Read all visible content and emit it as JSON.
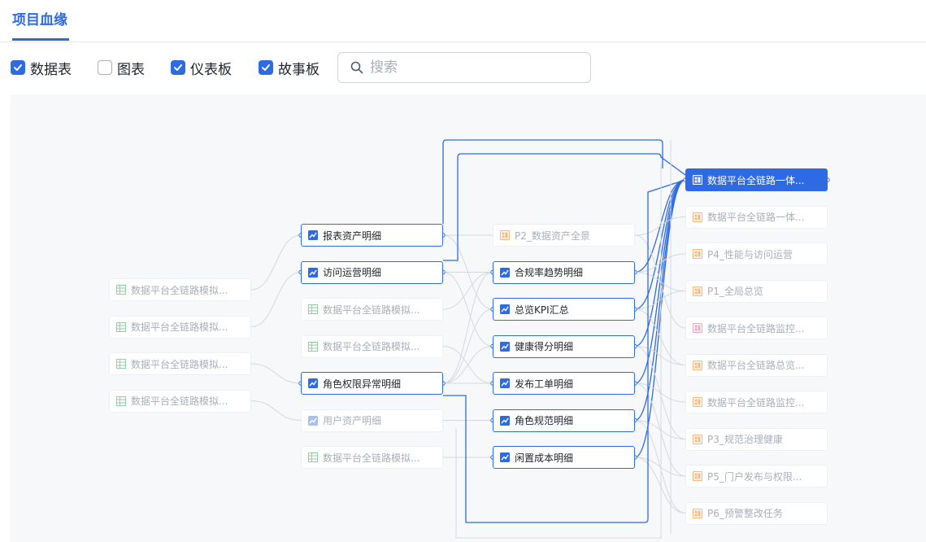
{
  "header": {
    "tab_label": "项目血缘"
  },
  "filters": [
    {
      "label": "数据表",
      "checked": true
    },
    {
      "label": "图表",
      "checked": false
    },
    {
      "label": "仪表板",
      "checked": true
    },
    {
      "label": "故事板",
      "checked": true
    }
  ],
  "search": {
    "placeholder": "搜索"
  },
  "colors": {
    "accent": "#2d6ae3",
    "table_icon": "#8fd19e",
    "chart_icon": "#2d6ae3",
    "dashboard_icon": "#f5b97f",
    "story_icon": "#f4a8bf"
  },
  "nodes": [
    {
      "id": "t1",
      "type": "table",
      "label": "数据平台全链路模拟...",
      "state": "dim",
      "col": 0,
      "row": 0
    },
    {
      "id": "t2",
      "type": "table",
      "label": "数据平台全链路模拟...",
      "state": "dim",
      "col": 0,
      "row": 1
    },
    {
      "id": "t3",
      "type": "table",
      "label": "数据平台全链路模拟...",
      "state": "dim",
      "col": 0,
      "row": 2
    },
    {
      "id": "t4",
      "type": "table",
      "label": "数据平台全链路模拟...",
      "state": "dim",
      "col": 0,
      "row": 3
    },
    {
      "id": "c1",
      "type": "chart",
      "label": "报表资产明细",
      "state": "active",
      "col": 1,
      "row": 0
    },
    {
      "id": "c2",
      "type": "chart",
      "label": "访问运营明细",
      "state": "active",
      "col": 1,
      "row": 1
    },
    {
      "id": "c3",
      "type": "table",
      "label": "数据平台全链路模拟...",
      "state": "dim",
      "col": 1,
      "row": 2
    },
    {
      "id": "c4",
      "type": "table",
      "label": "数据平台全链路模拟...",
      "state": "dim",
      "col": 1,
      "row": 3
    },
    {
      "id": "c5",
      "type": "chart",
      "label": "角色权限异常明细",
      "state": "active",
      "col": 1,
      "row": 4
    },
    {
      "id": "c6",
      "type": "chart",
      "label": "用户资产明细",
      "state": "dim",
      "col": 1,
      "row": 5
    },
    {
      "id": "c7",
      "type": "table",
      "label": "数据平台全链路模拟...",
      "state": "dim",
      "col": 1,
      "row": 6
    },
    {
      "id": "m0",
      "type": "dashboard",
      "label": "P2_数据资产全景",
      "state": "dim",
      "col": 2,
      "row": 0
    },
    {
      "id": "m1",
      "type": "chart",
      "label": "合规率趋势明细",
      "state": "active",
      "col": 2,
      "row": 1
    },
    {
      "id": "m2",
      "type": "chart",
      "label": "总览KPI汇总",
      "state": "active",
      "col": 2,
      "row": 2
    },
    {
      "id": "m3",
      "type": "chart",
      "label": "健康得分明细",
      "state": "active",
      "col": 2,
      "row": 3
    },
    {
      "id": "m4",
      "type": "chart",
      "label": "发布工单明细",
      "state": "active",
      "col": 2,
      "row": 4
    },
    {
      "id": "m5",
      "type": "chart",
      "label": "角色规范明细",
      "state": "active",
      "col": 2,
      "row": 5
    },
    {
      "id": "m6",
      "type": "chart",
      "label": "闲置成本明细",
      "state": "active",
      "col": 2,
      "row": 6
    },
    {
      "id": "d0",
      "type": "dashboard",
      "label": "数据平台全链路一体...",
      "state": "selected",
      "col": 3,
      "row": 0
    },
    {
      "id": "d1",
      "type": "dashboard",
      "label": "数据平台全链路一体...",
      "state": "dim",
      "col": 3,
      "row": 1
    },
    {
      "id": "d2",
      "type": "dashboard",
      "label": "P4_性能与访问运营",
      "state": "dim",
      "col": 3,
      "row": 2
    },
    {
      "id": "d3",
      "type": "dashboard",
      "label": "P1_全局总览",
      "state": "dim",
      "col": 3,
      "row": 3
    },
    {
      "id": "d4",
      "type": "story",
      "label": "数据平台全链路监控...",
      "state": "dim",
      "col": 3,
      "row": 4
    },
    {
      "id": "d5",
      "type": "dashboard",
      "label": "数据平台全链路总览...",
      "state": "dim",
      "col": 3,
      "row": 5
    },
    {
      "id": "d6",
      "type": "dashboard",
      "label": "数据平台全链路监控...",
      "state": "dim",
      "col": 3,
      "row": 6
    },
    {
      "id": "d7",
      "type": "dashboard",
      "label": "P3_规范治理健康",
      "state": "dim",
      "col": 3,
      "row": 7
    },
    {
      "id": "d8",
      "type": "dashboard",
      "label": "P5_门户发布与权限...",
      "state": "dim",
      "col": 3,
      "row": 8
    },
    {
      "id": "d9",
      "type": "dashboard",
      "label": "P6_预警整改任务",
      "state": "dim",
      "col": 3,
      "row": 9
    }
  ],
  "edges": [
    [
      "t1",
      "c1",
      false
    ],
    [
      "t2",
      "c2",
      false
    ],
    [
      "t3",
      "c5",
      false
    ],
    [
      "t4",
      "c6",
      false
    ],
    [
      "c1",
      "m0",
      false
    ],
    [
      "c1",
      "m2",
      false
    ],
    [
      "c2",
      "m1",
      false
    ],
    [
      "c2",
      "m3",
      false
    ],
    [
      "c3",
      "m1",
      false
    ],
    [
      "c4",
      "m4",
      false
    ],
    [
      "c5",
      "m1",
      false
    ],
    [
      "c5",
      "m2",
      false
    ],
    [
      "c5",
      "m3",
      false
    ],
    [
      "c5",
      "m4",
      false
    ],
    [
      "c6",
      "m5",
      false
    ],
    [
      "c7",
      "m6",
      false
    ],
    [
      "m1",
      "d0",
      true
    ],
    [
      "m2",
      "d0",
      true
    ],
    [
      "m3",
      "d0",
      true
    ],
    [
      "m4",
      "d0",
      true
    ],
    [
      "m5",
      "d0",
      true
    ],
    [
      "m6",
      "d0",
      true
    ],
    [
      "m1",
      "d2",
      false
    ],
    [
      "m1",
      "d3",
      false
    ],
    [
      "m2",
      "d3",
      false
    ],
    [
      "m2",
      "d5",
      false
    ],
    [
      "m3",
      "d5",
      false
    ],
    [
      "m3",
      "d7",
      false
    ],
    [
      "m4",
      "d6",
      false
    ],
    [
      "m4",
      "d8",
      false
    ],
    [
      "m5",
      "d7",
      false
    ],
    [
      "m5",
      "d9",
      false
    ],
    [
      "m6",
      "d8",
      false
    ],
    [
      "m6",
      "d9",
      false
    ],
    [
      "m0",
      "d1",
      false
    ],
    [
      "m0",
      "d4",
      false
    ]
  ]
}
